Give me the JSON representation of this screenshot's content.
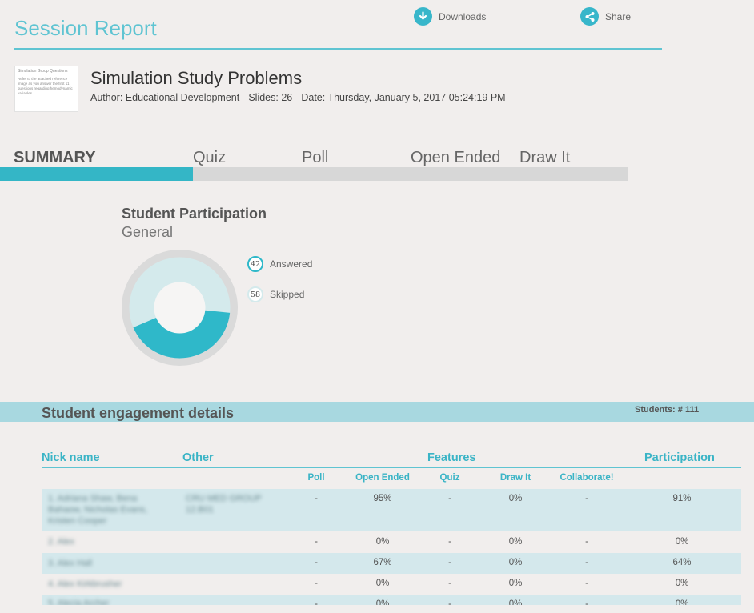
{
  "header": {
    "title": "Session Report",
    "downloads_label": "Downloads",
    "share_label": "Share"
  },
  "deck": {
    "thumbnail_title": "Simulation Group Questions",
    "thumbnail_text": "Refer to the attached reference image as you answer the first 11 questions regarding hemodynamic variables.",
    "title": "Simulation Study Problems",
    "meta": "Author: Educational Development - Slides: 26 - Date: Thursday, January 5, 2017 05:24:19 PM"
  },
  "tabs": [
    {
      "label": "SUMMARY",
      "active": true
    },
    {
      "label": "Quiz"
    },
    {
      "label": "Poll"
    },
    {
      "label": "Open Ended"
    },
    {
      "label": "Draw It"
    }
  ],
  "participation": {
    "title": "Student Participation",
    "subtitle": "General",
    "answered_count": "42",
    "answered_label": "Answered",
    "skipped_count": "58",
    "skipped_label": "Skipped",
    "answered_fraction": 0.42,
    "colors": {
      "answered": "#2fb8c9",
      "skipped": "#d4eaec",
      "ring": "#dadada"
    }
  },
  "engagement": {
    "title": "Student engagement details",
    "students_count": "Students: # 111",
    "headers": {
      "nick": "Nick name",
      "other": "Other",
      "features": "Features",
      "participation": "Participation"
    },
    "feature_columns": [
      "Poll",
      "Open Ended",
      "Quiz",
      "Draw It",
      "Collaborate!"
    ],
    "rows": [
      {
        "nick": "1. Adriana Shaw, Bena Bahaow, Nicholas Evans, Kristen Cooper",
        "other": "CRU MED GROUP 12.B01",
        "poll": "-",
        "open_ended": "95%",
        "quiz": "-",
        "draw_it": "0%",
        "collaborate": "-",
        "participation": "91%"
      },
      {
        "nick": "2. Alex",
        "other": "",
        "poll": "-",
        "open_ended": "0%",
        "quiz": "-",
        "draw_it": "0%",
        "collaborate": "-",
        "participation": "0%"
      },
      {
        "nick": "3. Alex Hall",
        "other": "",
        "poll": "-",
        "open_ended": "67%",
        "quiz": "-",
        "draw_it": "0%",
        "collaborate": "-",
        "participation": "64%"
      },
      {
        "nick": "4. Alex Kirkbrusher",
        "other": "",
        "poll": "-",
        "open_ended": "0%",
        "quiz": "-",
        "draw_it": "0%",
        "collaborate": "-",
        "participation": "0%"
      },
      {
        "nick": "5. Alecia Archer",
        "other": "",
        "poll": "-",
        "open_ended": "0%",
        "quiz": "-",
        "draw_it": "0%",
        "collaborate": "-",
        "participation": "0%"
      }
    ]
  }
}
